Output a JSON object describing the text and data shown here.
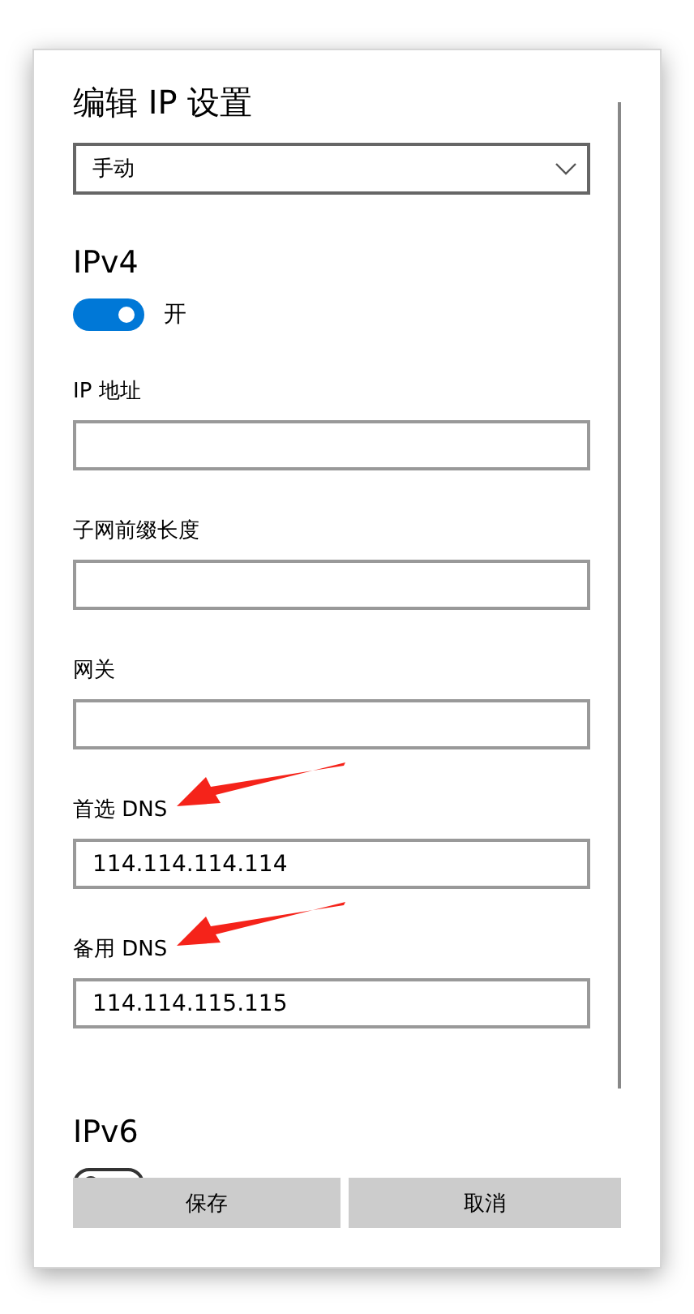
{
  "title": "编辑 IP 设置",
  "mode_dropdown": {
    "value": "手动"
  },
  "ipv4": {
    "heading": "IPv4",
    "toggle": {
      "on": true,
      "label": "开"
    },
    "fields": [
      {
        "label": "IP 地址",
        "arrow": false
      },
      {
        "label": "子网前缀长度",
        "arrow": false
      },
      {
        "label": "网关",
        "arrow": false
      },
      {
        "label": "首选 DNS",
        "value": "114.114.114.114",
        "arrow": true
      },
      {
        "label": "备用 DNS",
        "value": "114.114.115.115",
        "arrow": true
      }
    ]
  },
  "ipv6": {
    "heading": "IPv6",
    "toggle": {
      "on": false
    }
  },
  "buttons": [
    "保存",
    "取消"
  ]
}
